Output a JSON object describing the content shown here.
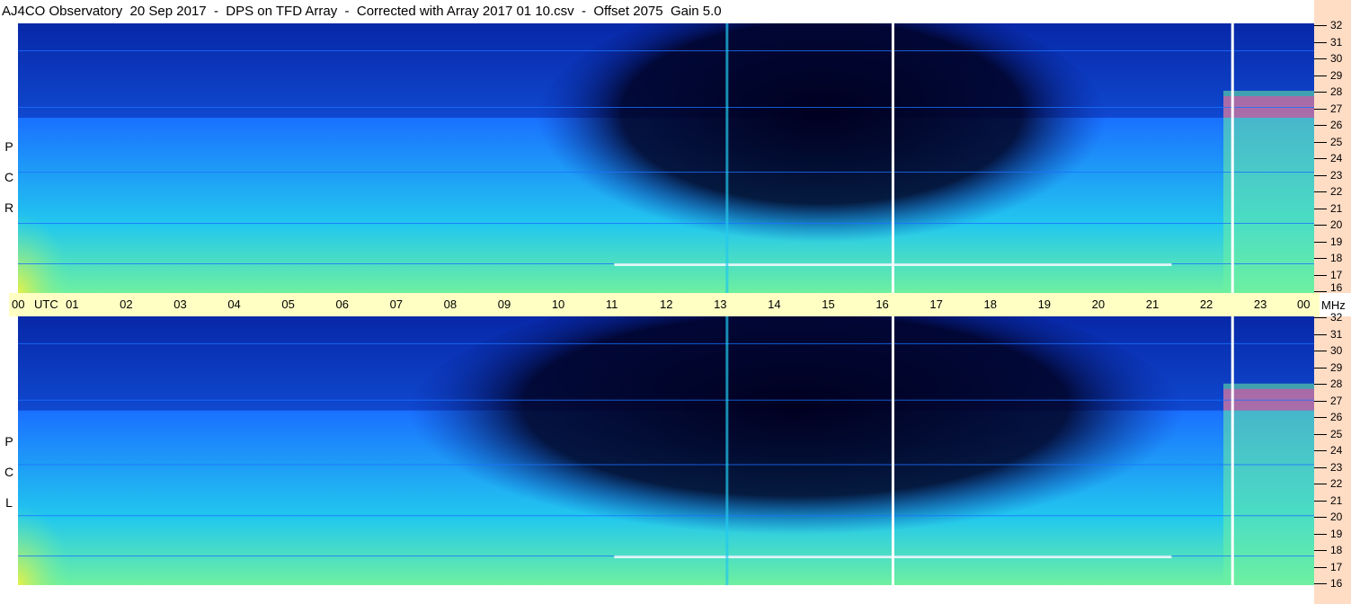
{
  "title": "AJ4CO Observatory  20 Sep 2017  -  DPS on TFD Array  -  Corrected with Array 2017 01 10.csv  -  Offset 2075  Gain 5.0",
  "chart_data": {
    "type": "heatmap",
    "title": "AJ4CO Observatory  20 Sep 2017  -  DPS on TFD Array  -  Corrected with Array 2017 01 10.csv  -  Offset 2075  Gain 5.0",
    "x_axis": {
      "unit_label": "UTC",
      "ticks": [
        "00",
        "01",
        "02",
        "03",
        "04",
        "05",
        "06",
        "07",
        "08",
        "09",
        "10",
        "11",
        "12",
        "13",
        "14",
        "15",
        "16",
        "17",
        "18",
        "19",
        "20",
        "21",
        "22",
        "23",
        "00"
      ],
      "range": [
        0,
        24
      ]
    },
    "y_axis": {
      "unit_label": "MHz",
      "ticks": [
        "32",
        "31",
        "30",
        "29",
        "28",
        "27",
        "26",
        "25",
        "24",
        "23",
        "22",
        "21",
        "20",
        "19",
        "18",
        "17",
        "16"
      ],
      "range": [
        16,
        32
      ]
    },
    "panels": [
      {
        "polarization": [
          "R",
          "C",
          "P"
        ]
      },
      {
        "polarization": [
          "L",
          "C",
          "P"
        ]
      }
    ],
    "colormap": [
      "#000020",
      "#0828a8",
      "#1a70ff",
      "#22c8ee",
      "#6ef0a0",
      "#f0f040",
      "#ff40a0",
      "#ffffff"
    ]
  }
}
